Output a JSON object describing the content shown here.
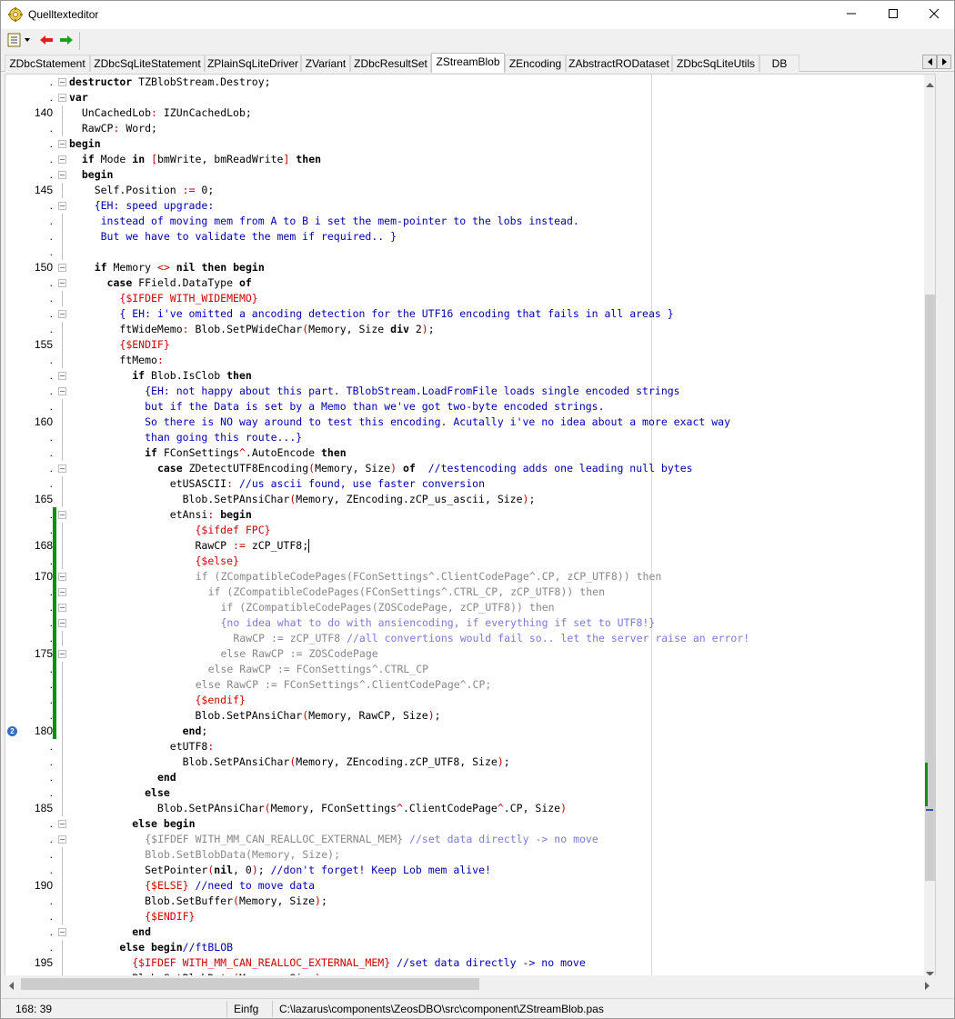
{
  "window": {
    "title": "Quelltexteditor",
    "icons": {
      "app": "app-icon",
      "minimize": "minimize-icon",
      "maximize": "maximize-icon",
      "close": "close-icon"
    }
  },
  "toolbar": {
    "items": [
      {
        "name": "jump-list-button",
        "icon": "list-icon"
      },
      {
        "name": "back-button",
        "icon": "arrow-left-icon",
        "color": "#e02020"
      },
      {
        "name": "forward-button",
        "icon": "arrow-right-icon",
        "color": "#20a020"
      }
    ]
  },
  "tabs": {
    "items": [
      "ZDbcStatement",
      "ZDbcSqLiteStatement",
      "ZPlainSqLiteDriver",
      "ZVariant",
      "ZDbcResultSet",
      "ZStreamBlob",
      "ZEncoding",
      "ZAbstractRODataset",
      "ZDbcSqLiteUtils",
      "DB"
    ],
    "active": "ZStreamBlob"
  },
  "editor": {
    "lines": [
      {
        "n": ".",
        "t": "destructor TZBlobStream.Destroy;"
      },
      {
        "n": ".",
        "t": "var"
      },
      {
        "n": "140",
        "t": "  UnCachedLob: IZUnCachedLob;"
      },
      {
        "n": ".",
        "t": "  RawCP: Word;"
      },
      {
        "n": ".",
        "t": "begin"
      },
      {
        "n": ".",
        "t": "  if Mode in [bmWrite, bmReadWrite] then"
      },
      {
        "n": ".",
        "t": "  begin"
      },
      {
        "n": "145",
        "t": "    Self.Position := 0;"
      },
      {
        "n": ".",
        "t": "    {EH: speed upgrade:"
      },
      {
        "n": ".",
        "t": "     instead of moving mem from A to B i set the mem-pointer to the lobs instead."
      },
      {
        "n": ".",
        "t": "     But we have to validate the mem if required.. }"
      },
      {
        "n": ".",
        "t": ""
      },
      {
        "n": "150",
        "t": "    if Memory <> nil then begin"
      },
      {
        "n": ".",
        "t": "      case FField.DataType of"
      },
      {
        "n": ".",
        "t": "        {$IFDEF WITH_WIDEMEMO}"
      },
      {
        "n": ".",
        "t": "        { EH: i've omitted a ancoding detection for the UTF16 encoding that fails in all areas }"
      },
      {
        "n": ".",
        "t": "        ftWideMemo: Blob.SetPWideChar(Memory, Size div 2);"
      },
      {
        "n": "155",
        "t": "        {$ENDIF}"
      },
      {
        "n": ".",
        "t": "        ftMemo:"
      },
      {
        "n": ".",
        "t": "          if Blob.IsClob then"
      },
      {
        "n": ".",
        "t": "            {EH: not happy about this part. TBlobStream.LoadFromFile loads single encoded strings"
      },
      {
        "n": ".",
        "t": "            but if the Data is set by a Memo than we've got two-byte encoded strings."
      },
      {
        "n": "160",
        "t": "            So there is NO way around to test this encoding. Acutally i've no idea about a more exact way"
      },
      {
        "n": ".",
        "t": "            than going this route...}"
      },
      {
        "n": ".",
        "t": "            if FConSettings^.AutoEncode then"
      },
      {
        "n": ".",
        "t": "              case ZDetectUTF8Encoding(Memory, Size) of  //testencoding adds one leading null bytes"
      },
      {
        "n": ".",
        "t": "                etUSASCII: //us ascii found, use faster conversion"
      },
      {
        "n": "165",
        "t": "                  Blob.SetPAnsiChar(Memory, ZEncoding.zCP_us_ascii, Size);"
      },
      {
        "n": ".",
        "t": "                etAnsi: begin"
      },
      {
        "n": ".",
        "t": "                    {$ifdef FPC}"
      },
      {
        "n": "168",
        "t": "                    RawCP := zCP_UTF8;"
      },
      {
        "n": ".",
        "t": "                    {$else}"
      },
      {
        "n": "170",
        "t": "                    if (ZCompatibleCodePages(FConSettings^.ClientCodePage^.CP, zCP_UTF8)) then"
      },
      {
        "n": ".",
        "t": "                      if (ZCompatibleCodePages(FConSettings^.CTRL_CP, zCP_UTF8)) then"
      },
      {
        "n": ".",
        "t": "                        if (ZCompatibleCodePages(ZOSCodePage, zCP_UTF8)) then"
      },
      {
        "n": ".",
        "t": "                        {no idea what to do with ansiencoding, if everything if set to UTF8!}"
      },
      {
        "n": ".",
        "t": "                          RawCP := zCP_UTF8 //all convertions would fail so.. let the server raise an error!"
      },
      {
        "n": "175",
        "t": "                        else RawCP := ZOSCodePage"
      },
      {
        "n": ".",
        "t": "                      else RawCP := FConSettings^.CTRL_CP"
      },
      {
        "n": ".",
        "t": "                    else RawCP := FConSettings^.ClientCodePage^.CP;"
      },
      {
        "n": ".",
        "t": "                    {$endif}"
      },
      {
        "n": ".",
        "t": "                    Blob.SetPAnsiChar(Memory, RawCP, Size);"
      },
      {
        "n": "180",
        "t": "                  end;"
      },
      {
        "n": ".",
        "t": "                etUTF8:"
      },
      {
        "n": ".",
        "t": "                  Blob.SetPAnsiChar(Memory, ZEncoding.zCP_UTF8, Size);"
      },
      {
        "n": ".",
        "t": "              end"
      },
      {
        "n": ".",
        "t": "            else"
      },
      {
        "n": "185",
        "t": "              Blob.SetPAnsiChar(Memory, FConSettings^.ClientCodePage^.CP, Size)"
      },
      {
        "n": ".",
        "t": "          else begin"
      },
      {
        "n": ".",
        "t": "            {$IFDEF WITH_MM_CAN_REALLOC_EXTERNAL_MEM} //set data directly -> no move"
      },
      {
        "n": ".",
        "t": "            Blob.SetBlobData(Memory, Size);"
      },
      {
        "n": ".",
        "t": "            SetPointer(nil, 0); //don't forget! Keep Lob mem alive!"
      },
      {
        "n": "190",
        "t": "            {$ELSE} //need to move data"
      },
      {
        "n": ".",
        "t": "            Blob.SetBuffer(Memory, Size);"
      },
      {
        "n": ".",
        "t": "            {$ENDIF}"
      },
      {
        "n": ".",
        "t": "          end"
      },
      {
        "n": ".",
        "t": "        else begin//ftBLOB"
      },
      {
        "n": "195",
        "t": "          {$IFDEF WITH_MM_CAN_REALLOC_EXTERNAL_MEM} //set data directly -> no move"
      },
      {
        "n": ".",
        "t": "          Blob.SetBlobData(Memory, Size);"
      }
    ],
    "bookmark": {
      "line": "2",
      "icon": "bookmark-icon"
    },
    "colors": {
      "keyword": "#000000",
      "comment": "#0000b0",
      "directive": "#d00000",
      "inactive": "#888888",
      "changed": "#109010"
    }
  },
  "status": {
    "position": "168: 39",
    "mode": "Einfg",
    "path": "C:\\lazarus\\components\\ZeosDBO\\src\\component\\ZStreamBlob.pas"
  }
}
